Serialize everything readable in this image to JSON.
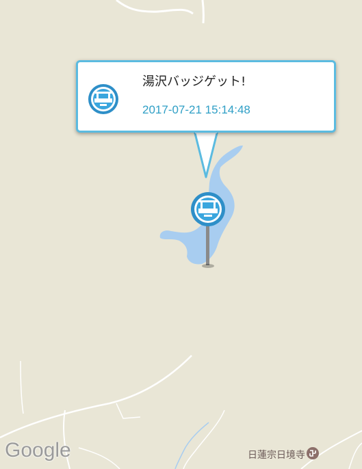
{
  "callout": {
    "title": "湯沢バッジゲット!",
    "timestamp": "2017-07-21 15:14:48",
    "icon": "badge-icon"
  },
  "marker": {
    "icon": "badge-pin-icon"
  },
  "map": {
    "attribution": "Google",
    "poi": {
      "label": "日蓮宗日境寺",
      "icon": "temple-icon"
    },
    "colors": {
      "land": "#e9e6d6",
      "water": "#a8cdf0",
      "road": "#ffffff",
      "accent": "#5bbbe0"
    }
  }
}
